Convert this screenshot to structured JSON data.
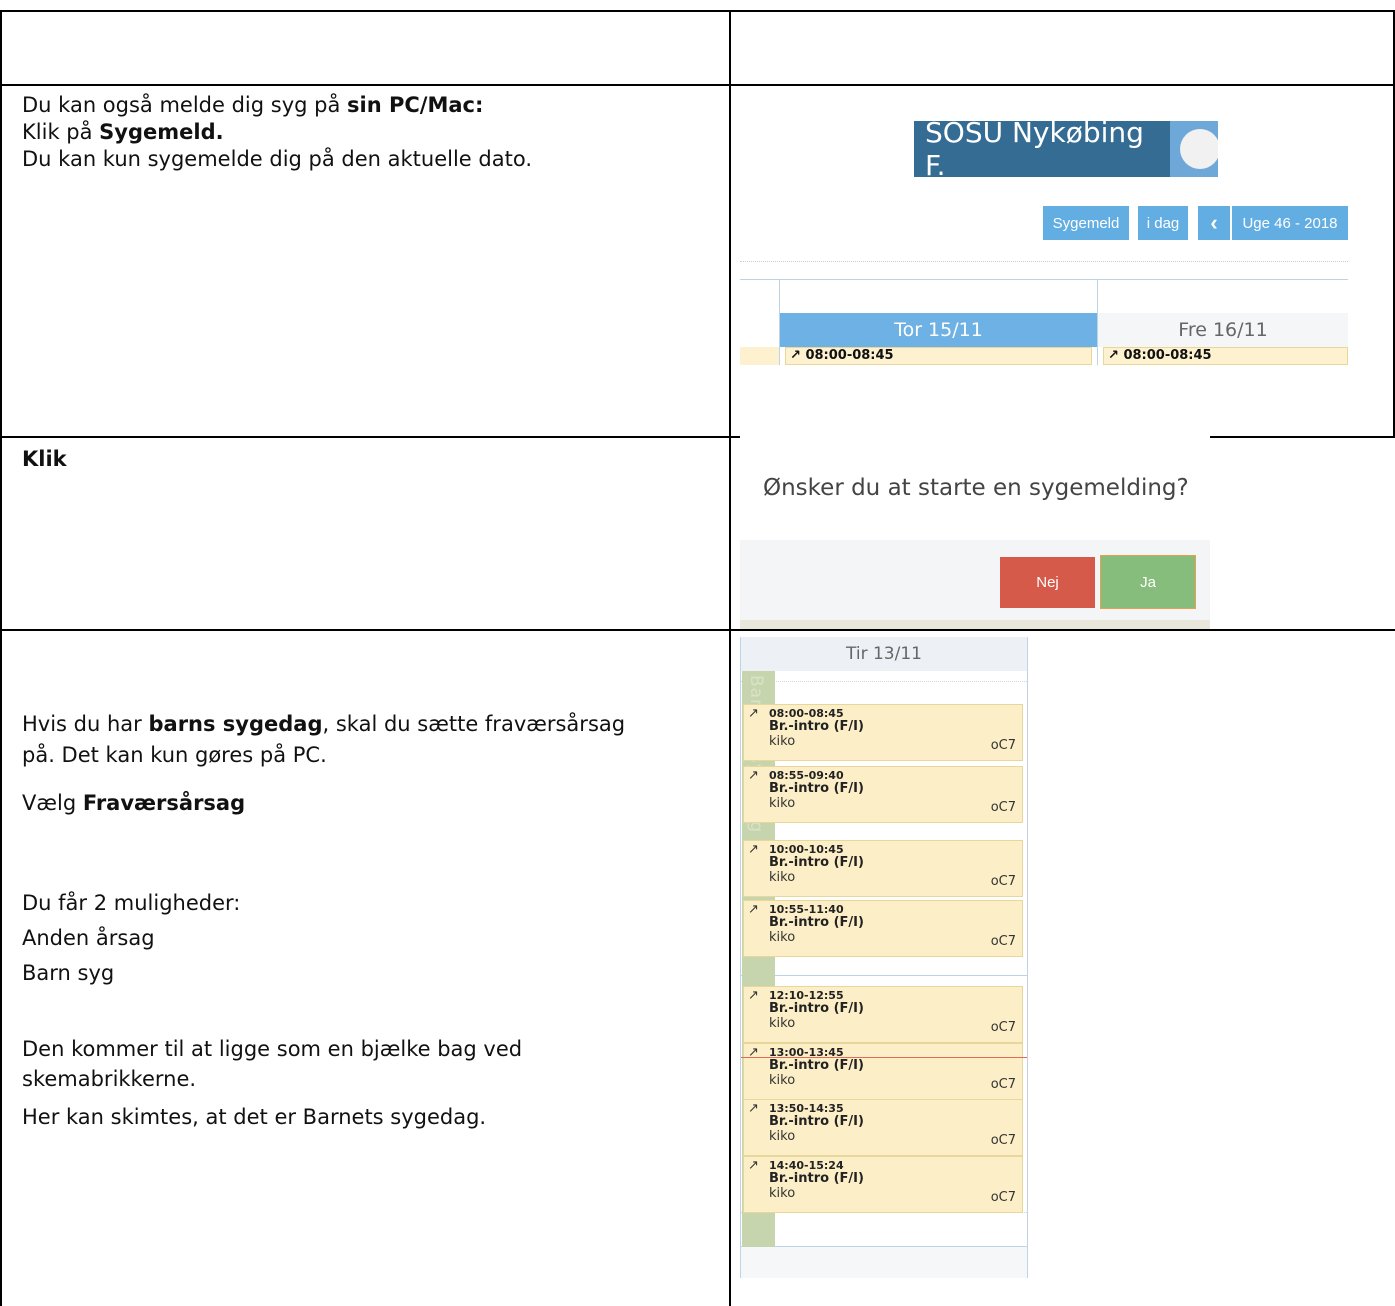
{
  "row2": {
    "l1_pre": "Du kan også melde dig syg på ",
    "l1_bold": "sin PC/Mac:",
    "l2_pre": "Klik på ",
    "l2_bold": "Sygemeld.",
    "l3": "Du kan kun sygemelde dig på den aktuelle dato."
  },
  "shot1": {
    "brand": "SOSU Nykøbing F.",
    "buttons": {
      "sick": "Sygemeld",
      "today": "i dag",
      "prev": "‹",
      "week": "Uge 46 - 2018"
    },
    "days": [
      "Tor 15/11",
      "Fre 16/11"
    ],
    "time": "08:00-08:45"
  },
  "row3": {
    "label": "Klik"
  },
  "shot2": {
    "question": "Ønsker du at starte en sygemelding?",
    "no": "Nej",
    "yes": "Ja"
  },
  "row4": {
    "p1_pre": "Hvis du har ",
    "p1_bold": "barns sygedag",
    "p1_post": ", skal du sætte fraværsårsag",
    "p1_l2": "på.  Det kan kun gøres på PC.",
    "p2_pre": "Vælg ",
    "p2_bold": "Fraværsårsag",
    "p3": "Du får 2 muligheder:",
    "p3_o1": "Anden årsag",
    "p3_o2": "Barn syg",
    "p4_l1": "Den kommer til at ligge som en bjælke bag ved",
    "p4_l2": "skemabrikkerne.",
    "p4_l3": "Her kan skimtes, at det er Barnets sygedag."
  },
  "shot3": {
    "day": "Tir 13/11",
    "bar_text": "Barnets sygedag",
    "events": [
      {
        "time": "08:00-08:45",
        "subject": "Br.-intro (F/I)",
        "teacher": "kiko",
        "room": "oC7"
      },
      {
        "time": "08:55-09:40",
        "subject": "Br.-intro (F/I)",
        "teacher": "kiko",
        "room": "oC7"
      },
      {
        "time": "10:00-10:45",
        "subject": "Br.-intro (F/I)",
        "teacher": "kiko",
        "room": "oC7"
      },
      {
        "time": "10:55-11:40",
        "subject": "Br.-intro (F/I)",
        "teacher": "kiko",
        "room": "oC7"
      },
      {
        "time": "12:10-12:55",
        "subject": "Br.-intro (F/I)",
        "teacher": "kiko",
        "room": "oC7"
      },
      {
        "time": "13:00-13:45",
        "subject": "Br.-intro (F/I)",
        "teacher": "kiko",
        "room": "oC7"
      },
      {
        "time": "13:50-14:35",
        "subject": "Br.-intro (F/I)",
        "teacher": "kiko",
        "room": "oC7"
      },
      {
        "time": "14:40-15:24",
        "subject": "Br.-intro (F/I)",
        "teacher": "kiko",
        "room": "oC7"
      }
    ]
  }
}
